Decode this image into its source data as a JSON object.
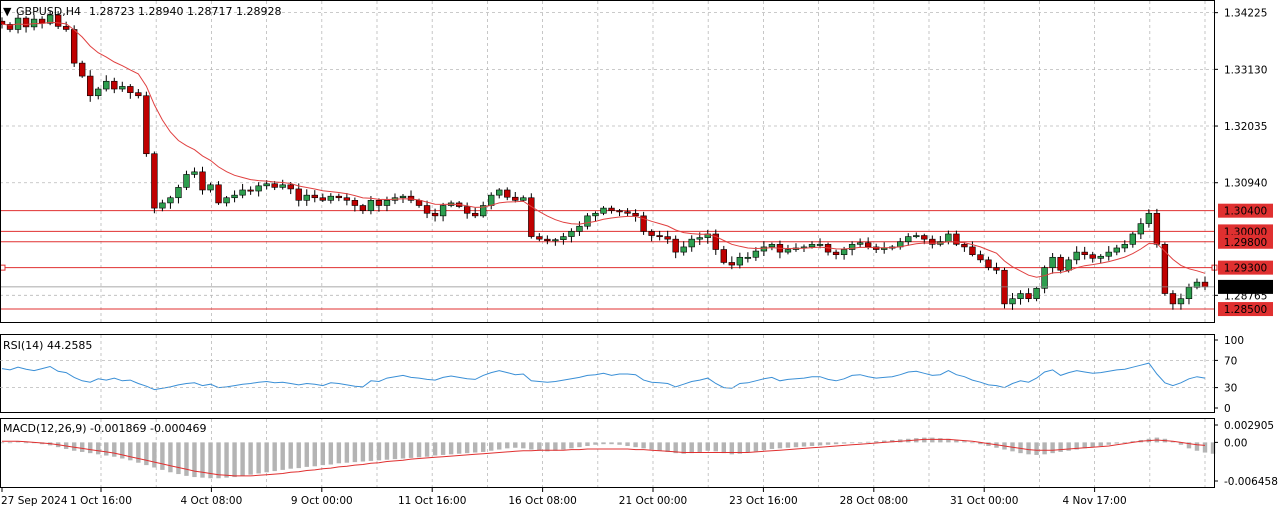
{
  "header": {
    "symbol_timeframe": "GBPUSD,H4",
    "ohlc_values": "1.28723 1.28940 1.28717 1.28928"
  },
  "colors": {
    "bull": "#2e9e4f",
    "bear": "#c00000",
    "ma_line": "#e04040",
    "level_line": "#e03030",
    "rsi_line": "#3a8fd6",
    "macd_hist": "#b4b4b4",
    "macd_signal": "#e03030",
    "grid": "#b9b9b9",
    "price_tag_bg": "#000000",
    "level_tag_bg": "#e03030"
  },
  "chart_data": [
    {
      "type": "candlestick",
      "title": "GBPUSD,H4",
      "ylim": [
        1.2825,
        1.3445
      ],
      "y_ticks": [
        "1.34225",
        "1.33130",
        "1.32035",
        "1.30940",
        "1.28765"
      ],
      "x_ticks": [
        "27 Sep 2024",
        "1 Oct 16:00",
        "4 Oct 08:00",
        "9 Oct 00:00",
        "11 Oct 16:00",
        "16 Oct 08:00",
        "21 Oct 00:00",
        "23 Oct 16:00",
        "28 Oct 08:00",
        "31 Oct 00:00",
        "4 Nov 17:00"
      ],
      "current_price": "1.28928",
      "levels": [
        "1.30400",
        "1.30000",
        "1.29800",
        "1.29300",
        "1.28500"
      ],
      "close_series": [
        1.34,
        1.339,
        1.3412,
        1.3395,
        1.341,
        1.3402,
        1.3418,
        1.3396,
        1.339,
        1.3325,
        1.33,
        1.3262,
        1.3275,
        1.329,
        1.3275,
        1.328,
        1.3268,
        1.3262,
        1.315,
        1.3045,
        1.3055,
        1.3065,
        1.3085,
        1.311,
        1.3115,
        1.308,
        1.309,
        1.3055,
        1.3065,
        1.307,
        1.308,
        1.3078,
        1.3088,
        1.3092,
        1.3085,
        1.309,
        1.3082,
        1.306,
        1.307,
        1.3065,
        1.306,
        1.3068,
        1.3065,
        1.306,
        1.305,
        1.304,
        1.306,
        1.305,
        1.306,
        1.3065,
        1.3068,
        1.306,
        1.305,
        1.3035,
        1.303,
        1.305,
        1.3055,
        1.3048,
        1.3035,
        1.303,
        1.305,
        1.307,
        1.308,
        1.3066,
        1.306,
        1.3065,
        1.299,
        1.2985,
        1.2982,
        1.2984,
        1.299,
        1.3,
        1.301,
        1.303,
        1.3035,
        1.3045,
        1.304,
        1.3038,
        1.3035,
        1.303,
        1.3,
        1.2992,
        1.299,
        1.2985,
        1.296,
        1.297,
        1.2985,
        1.2988,
        1.2995,
        1.2965,
        1.294,
        1.2935,
        1.295,
        1.295,
        1.2962,
        1.297,
        1.2975,
        1.296,
        1.2965,
        1.2968,
        1.297,
        1.2975,
        1.2975,
        1.296,
        1.2955,
        1.2965,
        1.2975,
        1.2978,
        1.297,
        1.2965,
        1.2968,
        1.297,
        1.298,
        1.299,
        1.2992,
        1.2985,
        1.2975,
        1.298,
        1.2995,
        1.2975,
        1.297,
        1.2955,
        1.2945,
        1.293,
        1.2925,
        1.286,
        1.287,
        1.288,
        1.287,
        1.289,
        1.293,
        1.295,
        1.2925,
        1.2945,
        1.296,
        1.2955,
        1.2948,
        1.2952,
        1.296,
        1.2968,
        1.2975,
        1.2995,
        1.3015,
        1.3035,
        1.2975,
        1.288,
        1.286,
        1.287,
        1.2892,
        1.2902,
        1.2893
      ]
    },
    {
      "type": "line",
      "title": "RSI(14) 44.2585",
      "ylim": [
        0,
        100
      ],
      "y_ticks": [
        "100",
        "70",
        "30",
        "0"
      ],
      "values": [
        58,
        56,
        60,
        57,
        55,
        58,
        61,
        54,
        52,
        45,
        40,
        38,
        43,
        41,
        44,
        40,
        41,
        36,
        32,
        27,
        29,
        31,
        34,
        36,
        37,
        33,
        35,
        30,
        31,
        33,
        35,
        36,
        38,
        39,
        37,
        38,
        36,
        34,
        36,
        35,
        33,
        37,
        36,
        34,
        32,
        31,
        40,
        39,
        44,
        46,
        48,
        45,
        44,
        42,
        41,
        45,
        47,
        45,
        43,
        42,
        48,
        52,
        55,
        52,
        49,
        50,
        40,
        39,
        38,
        39,
        41,
        43,
        45,
        48,
        49,
        51,
        48,
        50,
        50,
        49,
        41,
        38,
        37,
        36,
        31,
        35,
        39,
        41,
        44,
        36,
        30,
        29,
        36,
        37,
        40,
        43,
        45,
        40,
        42,
        43,
        44,
        46,
        46,
        42,
        40,
        43,
        48,
        49,
        46,
        44,
        45,
        46,
        49,
        53,
        54,
        51,
        48,
        49,
        55,
        49,
        46,
        41,
        38,
        34,
        33,
        30,
        36,
        40,
        38,
        44,
        53,
        56,
        48,
        52,
        55,
        53,
        51,
        52,
        54,
        56,
        57,
        60,
        63,
        66,
        50,
        37,
        33,
        37,
        43,
        46,
        44
      ]
    },
    {
      "type": "bar+line",
      "title": "MACD(12,26,9) -0.001869 -0.000469",
      "ylim": [
        -0.006458,
        0.002905
      ],
      "y_ticks": [
        "0.002905",
        "0.00",
        "-0.006458"
      ],
      "histogram": [
        -0.0001,
        0.0,
        0.0002,
        0.0,
        -0.0001,
        -0.0003,
        -0.0005,
        -0.0008,
        -0.0011,
        -0.0014,
        -0.0016,
        -0.0018,
        -0.002,
        -0.0022,
        -0.0024,
        -0.0027,
        -0.003,
        -0.0034,
        -0.0038,
        -0.0042,
        -0.0046,
        -0.005,
        -0.0053,
        -0.0056,
        -0.0058,
        -0.0059,
        -0.006,
        -0.006,
        -0.0059,
        -0.0058,
        -0.0056,
        -0.0054,
        -0.0052,
        -0.005,
        -0.0048,
        -0.0046,
        -0.0044,
        -0.0043,
        -0.0041,
        -0.004,
        -0.0038,
        -0.0037,
        -0.0035,
        -0.0034,
        -0.0033,
        -0.0032,
        -0.0031,
        -0.003,
        -0.0029,
        -0.0028,
        -0.0027,
        -0.0026,
        -0.0025,
        -0.0024,
        -0.0022,
        -0.0021,
        -0.002,
        -0.0019,
        -0.0018,
        -0.0017,
        -0.0016,
        -0.0014,
        -0.0012,
        -0.001,
        -0.0009,
        -0.001,
        -0.0012,
        -0.0014,
        -0.0015,
        -0.0014,
        -0.0012,
        -0.001,
        -0.0008,
        -0.0006,
        -0.0004,
        -0.0003,
        -0.0003,
        -0.0004,
        -0.0006,
        -0.0008,
        -0.001,
        -0.0012,
        -0.0014,
        -0.0016,
        -0.0018,
        -0.0019,
        -0.0018,
        -0.0016,
        -0.0014,
        -0.0015,
        -0.0018,
        -0.002,
        -0.0019,
        -0.0017,
        -0.0015,
        -0.0013,
        -0.0011,
        -0.001,
        -0.0009,
        -0.0008,
        -0.0007,
        -0.0006,
        -0.0005,
        -0.0004,
        -0.0003,
        -0.0002,
        -0.0001,
        0.0,
        0.0001,
        0.0002,
        0.0003,
        0.0004,
        0.0005,
        0.0006,
        0.0007,
        0.0008,
        0.0008,
        0.0007,
        0.0006,
        0.0004,
        0.0002,
        0.0,
        -0.0003,
        -0.0006,
        -0.0009,
        -0.0012,
        -0.0015,
        -0.0018,
        -0.002,
        -0.0021,
        -0.002,
        -0.0018,
        -0.0016,
        -0.0014,
        -0.0012,
        -0.001,
        -0.0008,
        -0.0006,
        -0.0004,
        -0.0002,
        0.0,
        0.0002,
        0.0004,
        0.0006,
        0.0008,
        0.0006,
        0.0002,
        -0.0004,
        -0.001,
        -0.0014,
        -0.0017,
        -0.0019
      ],
      "signal": [
        0.0002,
        0.0002,
        0.0002,
        0.0001,
        0.0,
        -0.0001,
        -0.0002,
        -0.0004,
        -0.0006,
        -0.0008,
        -0.001,
        -0.0012,
        -0.0014,
        -0.0016,
        -0.0018,
        -0.0021,
        -0.0024,
        -0.0027,
        -0.003,
        -0.0033,
        -0.0036,
        -0.0039,
        -0.0042,
        -0.0045,
        -0.0048,
        -0.005,
        -0.0052,
        -0.0054,
        -0.0055,
        -0.0056,
        -0.0056,
        -0.0056,
        -0.0055,
        -0.0054,
        -0.0053,
        -0.0052,
        -0.005,
        -0.0049,
        -0.0047,
        -0.0046,
        -0.0044,
        -0.0043,
        -0.0041,
        -0.004,
        -0.0038,
        -0.0037,
        -0.0035,
        -0.0034,
        -0.0032,
        -0.0031,
        -0.003,
        -0.0028,
        -0.0027,
        -0.0026,
        -0.0025,
        -0.0024,
        -0.0023,
        -0.0022,
        -0.0021,
        -0.002,
        -0.0019,
        -0.0018,
        -0.0017,
        -0.0016,
        -0.0015,
        -0.0014,
        -0.0014,
        -0.0013,
        -0.0013,
        -0.0013,
        -0.0013,
        -0.0012,
        -0.0012,
        -0.0011,
        -0.0011,
        -0.0011,
        -0.0011,
        -0.0011,
        -0.0011,
        -0.0012,
        -0.0012,
        -0.0013,
        -0.0014,
        -0.0015,
        -0.0016,
        -0.0017,
        -0.0017,
        -0.0017,
        -0.0017,
        -0.0017,
        -0.0017,
        -0.0017,
        -0.0017,
        -0.0017,
        -0.0016,
        -0.0015,
        -0.0014,
        -0.0013,
        -0.0012,
        -0.0011,
        -0.001,
        -0.0009,
        -0.0008,
        -0.0007,
        -0.0006,
        -0.0005,
        -0.0004,
        -0.0003,
        -0.0002,
        -0.0001,
        0.0,
        0.0001,
        0.0002,
        0.0003,
        0.0004,
        0.0005,
        0.0005,
        0.0005,
        0.0005,
        0.0004,
        0.0003,
        0.0002,
        0.0,
        -0.0002,
        -0.0004,
        -0.0006,
        -0.0008,
        -0.001,
        -0.0012,
        -0.0013,
        -0.0013,
        -0.0013,
        -0.0012,
        -0.0011,
        -0.001,
        -0.0009,
        -0.0008,
        -0.0007,
        -0.0006,
        -0.0004,
        -0.0002,
        0.0,
        0.0002,
        0.0003,
        0.0004,
        0.0003,
        0.0002,
        0.0,
        -0.0002,
        -0.0004,
        -0.0005
      ]
    }
  ]
}
